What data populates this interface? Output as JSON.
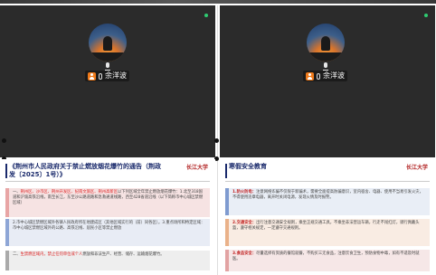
{
  "participants": [
    {
      "name": "余洋波",
      "mic": "on",
      "video": "avatar",
      "status_color": "#2ecc71"
    },
    {
      "name": "余洋波",
      "mic": "on",
      "video": "avatar",
      "status_color": "#2ecc71"
    }
  ],
  "slides": {
    "left": {
      "title": "《荆州市人民政府关于禁止燃放烟花爆竹的通告（荆政发〔2025〕1号）》",
      "logo": "长江大学",
      "blocks": [
        {
          "lead": "一、",
          "highlight": "荆州区、沙市区、荆州开发区、纪南文旅区、荆州高新区",
          "text": "以下列区域全年禁止燃放烟花爆竹：1.北至318国道和沪渝高铁沿线，南至长江，东至沙公路道路和急救通道线路，西至428省道沿线（以下简称市中心城区禁燃区域）"
        },
        {
          "lead": "",
          "highlight": "",
          "text": "2.市中心城区禁燃区域外各镇人民政府所在地建成区（其他区域实行的（前）同各区）。3.重点场所和特定区域：市中心城区禁燃区域外的公路、高铁沿线、居民小区等禁止燃放"
        },
        {
          "lead": "二、",
          "highlight": "生禁燃区域内，禁止任何单位或个人",
          "text": "燃放和非法生产、经营、储存、运输烟花爆竹。"
        }
      ]
    },
    "right": {
      "title": "寒假安全教育",
      "logo": "长江大学",
      "blocks": [
        {
          "head": "1.防火防电：",
          "text": "注意网络诈骗不仅限于新骗术，需要全面提高防骗意识，室内宿舍、电器、使用不当易引发火灾，不得使用违章电器，离开时关闭电源，发现火情及时报警。"
        },
        {
          "head": "2.交通安全：",
          "text": "出行注意交通安全规则，乘坐正规交通工具，不乘坐非法营运车辆，行走不闯红灯，骑行佩戴头盔，遵守相关规定，一定遵守交通规则。"
        },
        {
          "head": "3.食品安全：",
          "text": "尽量选择有资质的餐馆就餐，不购买三无食品，注意饮食卫生，预防食物中毒，如有不适及时就医。"
        }
      ]
    }
  }
}
